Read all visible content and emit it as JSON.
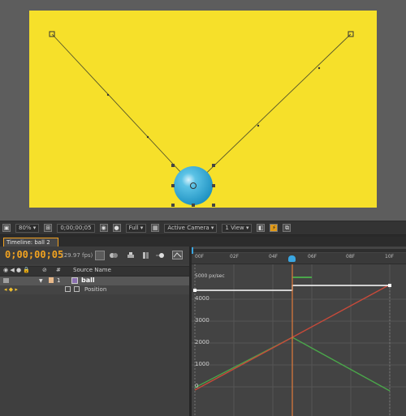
{
  "viewer": {
    "zoom": "80%",
    "timecode": "0;00;00;05",
    "resolution": "Full",
    "camera": "Active Camera",
    "views": "1 View"
  },
  "timeline": {
    "tab_label": "Timeline: ball 2",
    "current_time": "0;00;00;05",
    "fps": "(29.97 fps)",
    "col_number": "#",
    "col_source": "Source Name",
    "layer": {
      "index": "1",
      "name": "ball"
    },
    "property": "Position",
    "ruler_ticks": [
      "00F",
      "02F",
      "04F",
      "06F",
      "08F",
      "10F"
    ],
    "graph_axis_title": "5000 px/sec",
    "graph_y_labels": [
      "4000",
      "3000",
      "2000",
      "1000",
      "0"
    ]
  },
  "colors": {
    "canvas": "#f6e02a",
    "ball": "#29a9d4",
    "timecode": "#f2a320",
    "red_curve": "#c84a3a",
    "green_curve": "#4aa64a"
  },
  "icons": [
    "zoom-dropdown-icon",
    "camera-snapshot-icon",
    "grid-icon",
    "motion-blur-icon",
    "graph-editor-icon",
    "layer-video-icon"
  ]
}
